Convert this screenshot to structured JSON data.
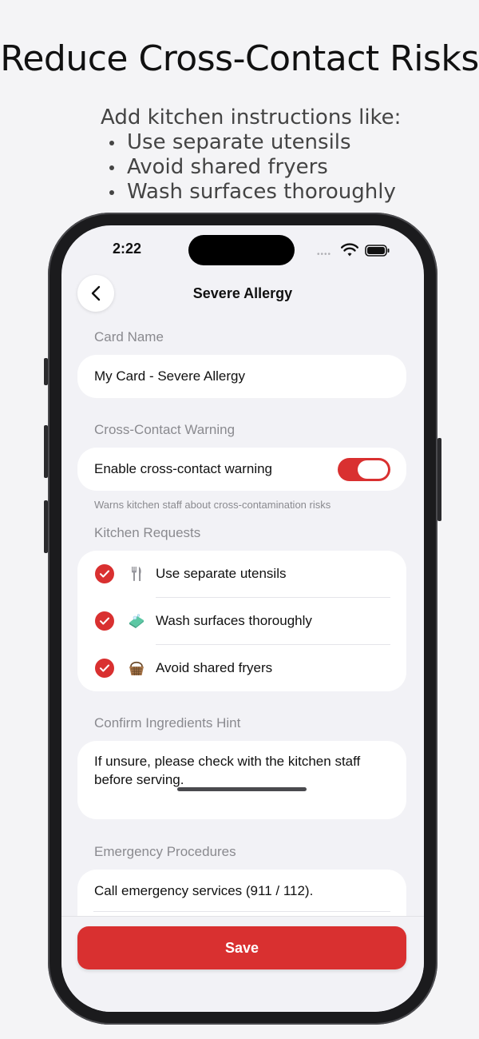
{
  "headline": "Reduce Cross-Contact Risks",
  "instructions": {
    "lead": "Add kitchen instructions like:",
    "items": [
      "Use separate utensils",
      "Avoid shared fryers",
      "Wash surfaces thoroughly"
    ]
  },
  "status_bar": {
    "time": "2:22",
    "signal_dots": "••••"
  },
  "nav": {
    "title": "Severe Allergy",
    "back_icon": "chevron-left-icon"
  },
  "card_name": {
    "label": "Card Name",
    "value": "My Card - Severe Allergy"
  },
  "cross_contact": {
    "label": "Cross-Contact Warning",
    "toggle_label": "Enable cross-contact warning",
    "enabled": true,
    "hint": "Warns kitchen staff about cross-contamination risks"
  },
  "kitchen_requests": {
    "label": "Kitchen Requests",
    "items": [
      {
        "label": "Use separate utensils",
        "icon": "fork-knife-icon",
        "checked": true
      },
      {
        "label": "Wash surfaces thoroughly",
        "icon": "soap-icon",
        "checked": true
      },
      {
        "label": "Avoid shared fryers",
        "icon": "basket-icon",
        "checked": true
      }
    ]
  },
  "confirm_hint": {
    "label": "Confirm Ingredients Hint",
    "value": "If unsure, please check with the kitchen staff before serving."
  },
  "emergency": {
    "label": "Emergency Procedures",
    "value": "Call emergency services (911 / 112)."
  },
  "save_label": "Save",
  "colors": {
    "accent": "#d93030",
    "background": "#f2f2f6",
    "card": "#ffffff",
    "muted_text": "#8a8a8f"
  }
}
